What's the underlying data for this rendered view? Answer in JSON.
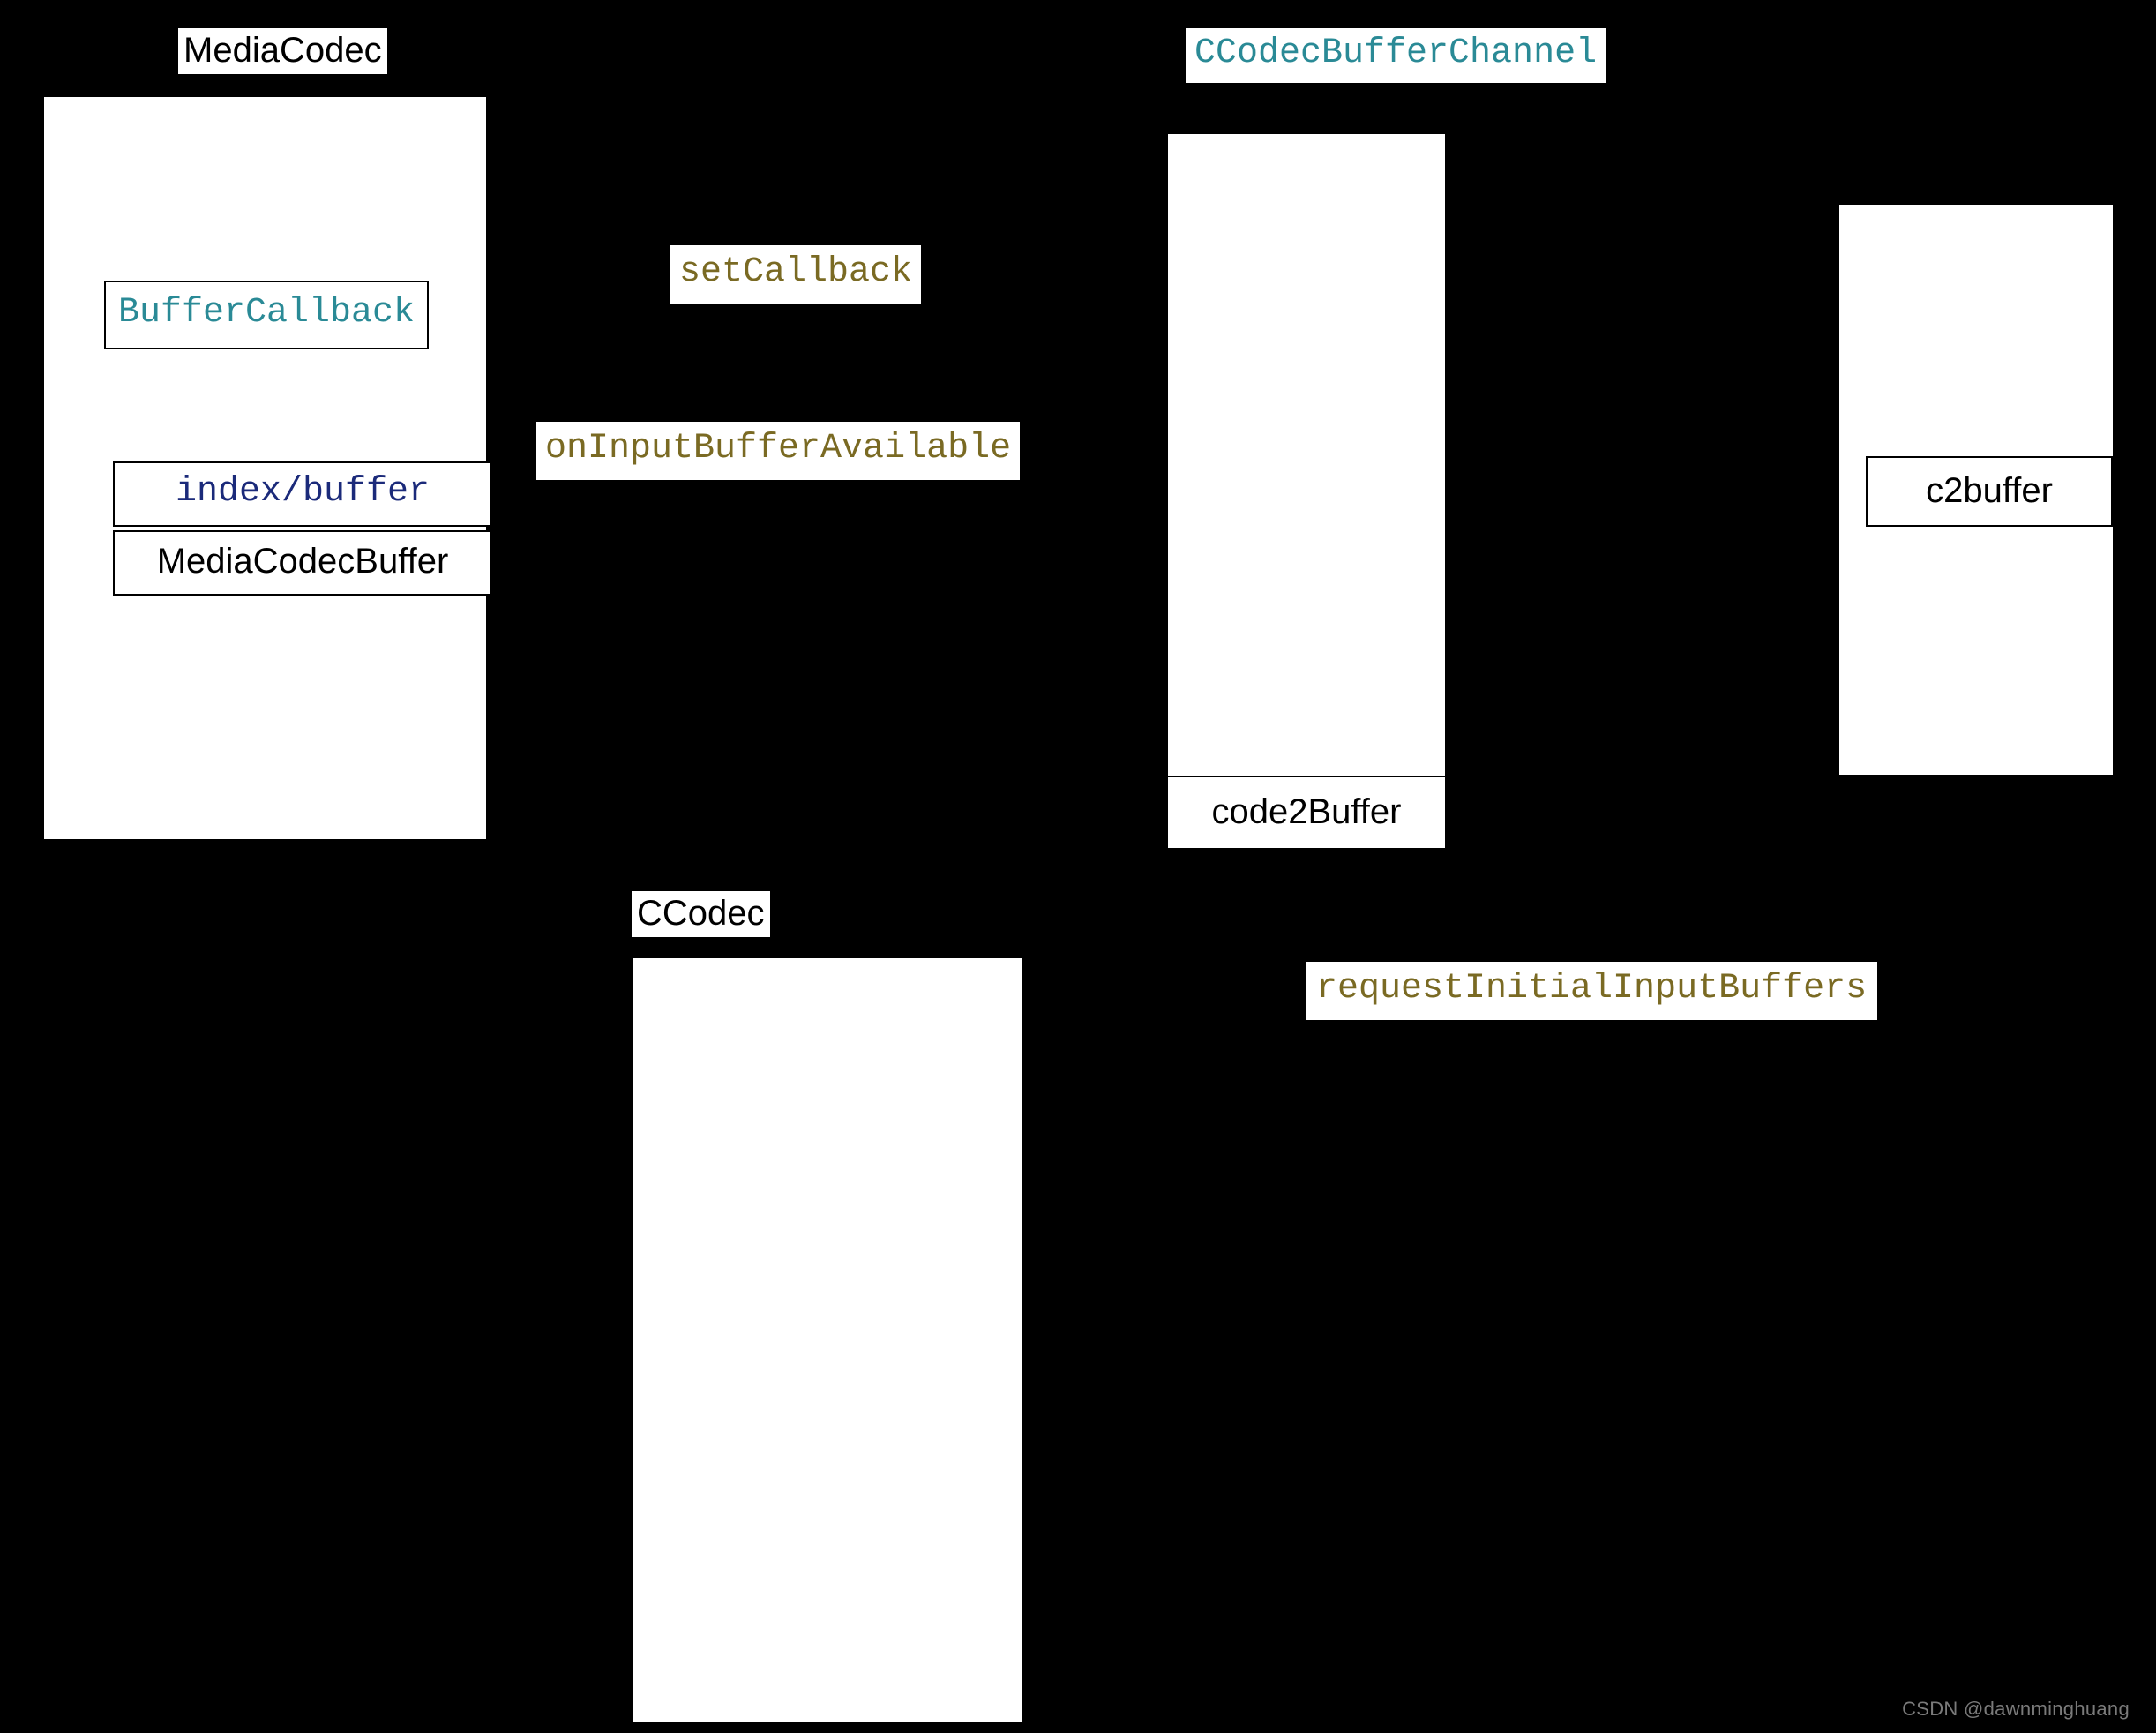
{
  "colors": {
    "background": "#000000",
    "box_fill": "#ffffff",
    "box_border": "#000000",
    "teal": "#2a8a96",
    "olive": "#7a6a23",
    "navy": "#1b2a7a"
  },
  "titles": {
    "mediacodec": "MediaCodec",
    "buffer_channel": "CCodecBufferChannel",
    "ccodec": "CCodec"
  },
  "boxes": {
    "mediacodec": {
      "buffer_callback": "BufferCallback",
      "index_buffer": "index/buffer",
      "mediacodec_buffer": "MediaCodecBuffer"
    },
    "buffer_channel": {
      "code2buffer": "code2Buffer"
    },
    "right": {
      "c2buffer": "c2buffer"
    }
  },
  "messages": {
    "set_callback": "setCallback",
    "on_input_buffer_available": "onInputBufferAvailable",
    "request_initial_input_buffers": "requestInitialInputBuffers"
  },
  "watermark": "CSDN @dawnminghuang"
}
